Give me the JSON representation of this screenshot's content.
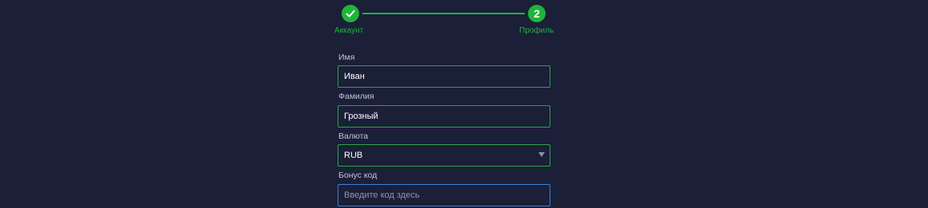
{
  "stepper": {
    "steps": [
      {
        "label": "Аккаунт",
        "icon": "checkmark-icon",
        "completed": true
      },
      {
        "label": "Профиль",
        "number": "2",
        "active": true
      }
    ],
    "accent_color": "#1fb43a"
  },
  "form": {
    "first_name": {
      "label": "Имя",
      "value": "Иван"
    },
    "last_name": {
      "label": "Фамилия",
      "value": "Грозный"
    },
    "currency": {
      "label": "Валюта",
      "value": "RUB"
    },
    "bonus_code": {
      "label": "Бонус код",
      "value": "",
      "placeholder": "Введите код здесь"
    }
  }
}
